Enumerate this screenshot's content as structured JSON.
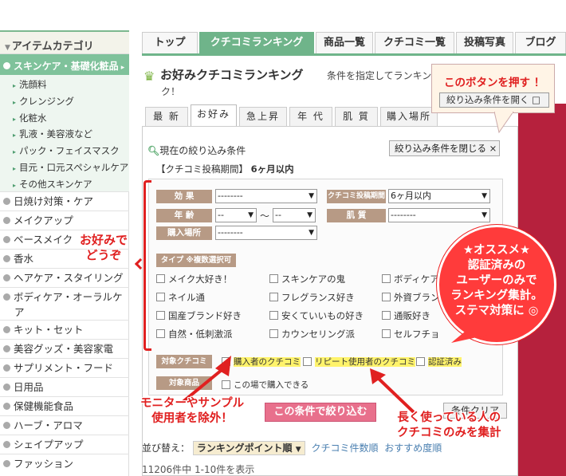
{
  "sidebar": {
    "heading": "アイテムカテゴリ",
    "active": "スキンケア・基礎化粧品",
    "sub": [
      "洗顔料",
      "クレンジング",
      "化粧水",
      "乳液・美容液など",
      "パック・フェイスマスク",
      "目元・口元スペシャルケア",
      "その他スキンケア"
    ],
    "items": [
      "日焼け対策・ケア",
      "メイクアップ",
      "ベースメイク",
      "香水",
      "ヘアケア・スタイリング",
      "ボディケア・オーラルケア",
      "キット・セット",
      "美容グッズ・美容家電",
      "サプリメント・フード",
      "日用品",
      "保健機能食品",
      "ハーブ・アロマ",
      "シェイプアップ",
      "ファッション"
    ]
  },
  "nav": {
    "tabs": [
      "トップ",
      "クチコミランキング",
      "商品一覧",
      "クチコミ一覧",
      "投稿写真",
      "ブログ"
    ]
  },
  "header": {
    "title": "お好みクチコミランキング",
    "desc": "条件を指定してランキン",
    "desc2": "ク！"
  },
  "subtabs": [
    "最 新",
    "お好み",
    "急上昇",
    "年 代",
    "肌 質",
    "購入場所"
  ],
  "filter": {
    "current_label": "現在の絞り込み条件",
    "close_button": "絞り込み条件を閉じる ×",
    "period_label": "【クチコミ投稿期間】",
    "period_value": "6ヶ月以内",
    "effect_label": "効 果",
    "effect_value": "--------",
    "post_period_label": "クチコミ投稿期間",
    "post_period_value": "6ヶ月以内",
    "age_label": "年 齢",
    "age_from": "--",
    "age_sep": "〜",
    "age_to": "--",
    "skin_label": "肌 質",
    "skin_value": "--------",
    "place_label": "購入場所",
    "place_value": "--------",
    "type_label": "タイプ ※複数選択可",
    "types": [
      [
        "メイク大好き！",
        "スキンケアの鬼",
        "ボディケア"
      ],
      [
        "ネイル通",
        "フレグランス好き",
        "外資ブラン"
      ],
      [
        "国産ブランド好き",
        "安くていいもの好き",
        "通販好き"
      ],
      [
        "自然・低刺激派",
        "カウンセリング派",
        "セルフチョ"
      ]
    ],
    "target_label": "対象クチコミ",
    "targets": [
      "購入者のクチコミ",
      "リピート使用者のクチコミ",
      "認証済み"
    ],
    "product_label": "対象商品",
    "product_option": "この場で購入できる",
    "submit": "この条件で絞り込む",
    "clear": "条件クリア"
  },
  "sort": {
    "label": "並び替え：",
    "selected": "ランキングポイント順",
    "options": [
      "クチコミ件数順",
      "おすすめ度順"
    ]
  },
  "result_count": "11206件中 1-10件を表示",
  "annotations": {
    "button_note": "このボタンを押す ！",
    "open_button": "絞り込み条件を開く □",
    "prefer_1": "お好みで",
    "prefer_2": "どうぞ",
    "bubble": [
      "★オススメ★",
      "認証済みの",
      "ユーザーのみで",
      "ランキング集計。",
      "ステマ対策に ◎"
    ],
    "monitor_1": "モニターやサンプル",
    "monitor_2": "使用者を除外！",
    "long_1": "長く使っている人の",
    "long_2": "クチコミのみを集計"
  },
  "colors": {
    "accent": "#6fb48a",
    "annotation": "#e02020",
    "label_bg": "#b79a85",
    "submit": "#e8708c"
  }
}
